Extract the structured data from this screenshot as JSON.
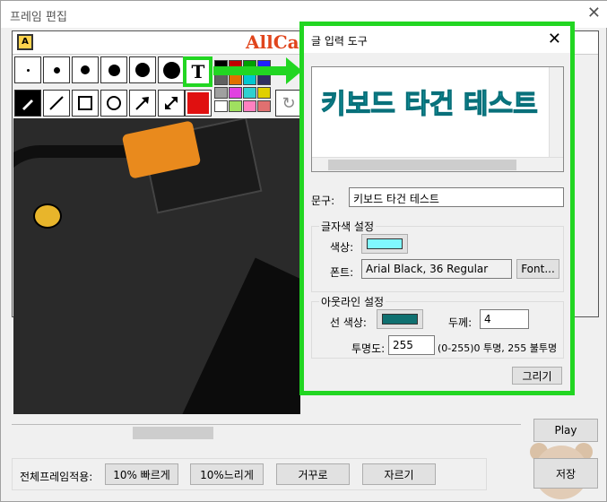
{
  "window": {
    "title": "프레임 편집",
    "close_symbol": "✕"
  },
  "editor": {
    "brand": "AllCa"
  },
  "toolbar": {
    "text_tool_glyph": "T",
    "swatches": [
      "#000000",
      "#c00000",
      "#00a000",
      "#2020ff",
      "#606060",
      "#e07000",
      "#00c8d0",
      "#303060",
      "#a0a0a0",
      "#e040e0",
      "#30d0d0",
      "#e0d000",
      "#ffffff",
      "#a0e060",
      "#ff80c0",
      "#e07070"
    ],
    "selected_color": "#e01010"
  },
  "bottom": {
    "label": "전체프레임적용:",
    "faster": "10% 빠르게",
    "slower": "10%느리게",
    "reverse": "거꾸로",
    "cut": "자르기"
  },
  "play": "Play",
  "save": "저장",
  "dialog": {
    "title": "글 입력 도구",
    "close_symbol": "✕",
    "preview_text": "키보드 타건 테스트",
    "text_label": "문구:",
    "text_value": "키보드 타건 테스트",
    "fill_group": "글자색 설정",
    "color_label": "색상:",
    "fill_color": "#80f8ff",
    "font_label": "폰트:",
    "font_value": "Arial Black, 36 Regular",
    "font_button": "Font...",
    "outline_group": "아웃라인 설정",
    "line_color_label": "선 색상:",
    "line_color": "#0f7070",
    "width_label": "두께:",
    "width_value": "4",
    "opacity_label": "투명도:",
    "opacity_value": "255",
    "opacity_hint": "(0-255)0 투명, 255 불투명",
    "draw_button": "그리기"
  }
}
